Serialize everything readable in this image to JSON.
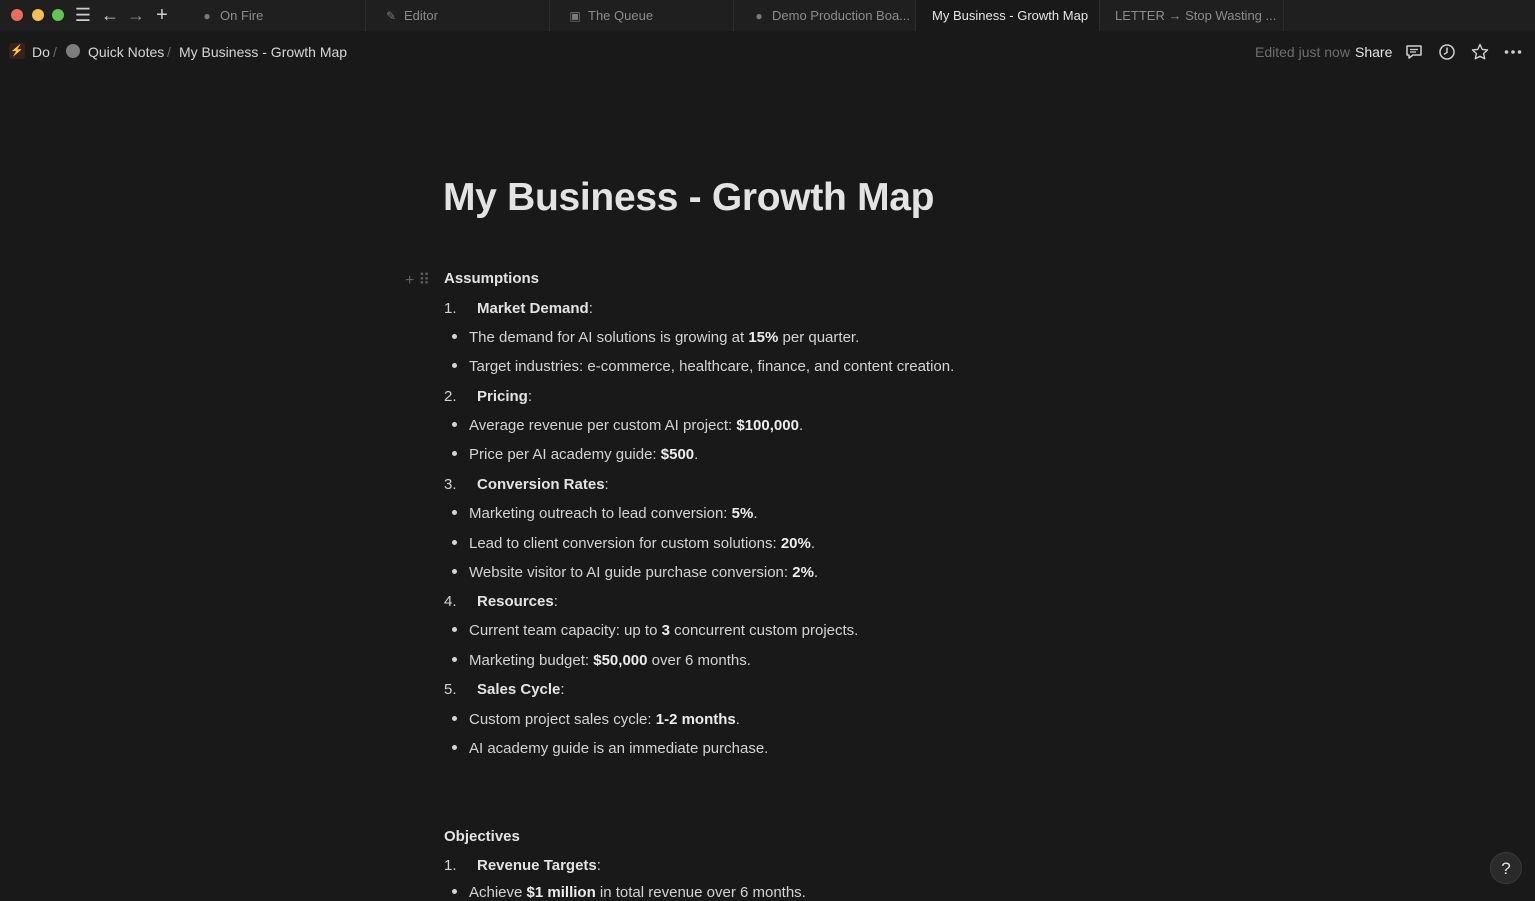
{
  "tabs": [
    {
      "label": "On Fire",
      "icon": "flame-icon"
    },
    {
      "label": "Editor",
      "icon": "pencil-icon"
    },
    {
      "label": "The Queue",
      "icon": "terminal-icon"
    },
    {
      "label": "Demo Production Boa...",
      "icon": "flame-icon"
    },
    {
      "label": "My Business - Growth Map",
      "icon": null,
      "active": true
    },
    {
      "label": "LETTER → Stop Wasting ...",
      "icon": null
    }
  ],
  "breadcrumb": {
    "workspace": "Do",
    "sep1": "/",
    "parent": "Quick Notes",
    "sep2": "/",
    "current": "My Business - Growth Map"
  },
  "topbar": {
    "edited": "Edited just now",
    "share": "Share"
  },
  "page": {
    "title": "My Business - Growth Map",
    "assumptions_heading": "Assumptions",
    "objectives_heading": "Objectives",
    "assumptions": [
      {
        "num": "1.",
        "label": "Market Demand",
        "bullets": [
          [
            "The demand for AI solutions is growing at ",
            "15%",
            " per quarter."
          ],
          [
            "Target industries: e-commerce, healthcare, finance, and content creation.",
            "",
            ""
          ]
        ]
      },
      {
        "num": "2.",
        "label": "Pricing",
        "bullets": [
          [
            "Average revenue per custom AI project: ",
            "$100,000",
            "."
          ],
          [
            "Price per AI academy guide: ",
            "$500",
            "."
          ]
        ]
      },
      {
        "num": "3.",
        "label": "Conversion Rates",
        "bullets": [
          [
            "Marketing outreach to lead conversion: ",
            "5%",
            "."
          ],
          [
            "Lead to client conversion for custom solutions: ",
            "20%",
            "."
          ],
          [
            "Website visitor to AI guide purchase conversion: ",
            "2%",
            "."
          ]
        ]
      },
      {
        "num": "4.",
        "label": "Resources",
        "bullets": [
          [
            "Current team capacity: up to ",
            "3",
            " concurrent custom projects."
          ],
          [
            "Marketing budget: ",
            "$50,000",
            " over 6 months."
          ]
        ]
      },
      {
        "num": "5.",
        "label": "Sales Cycle",
        "bullets": [
          [
            "Custom project sales cycle: ",
            "1-2 months",
            "."
          ],
          [
            "AI academy guide is an immediate purchase.",
            "",
            ""
          ]
        ]
      }
    ],
    "objectives": [
      {
        "num": "1.",
        "label": "Revenue Targets",
        "bullets": [
          [
            "Achieve ",
            "$1 million",
            " in total revenue over 6 months."
          ]
        ]
      }
    ]
  },
  "help_label": "?"
}
